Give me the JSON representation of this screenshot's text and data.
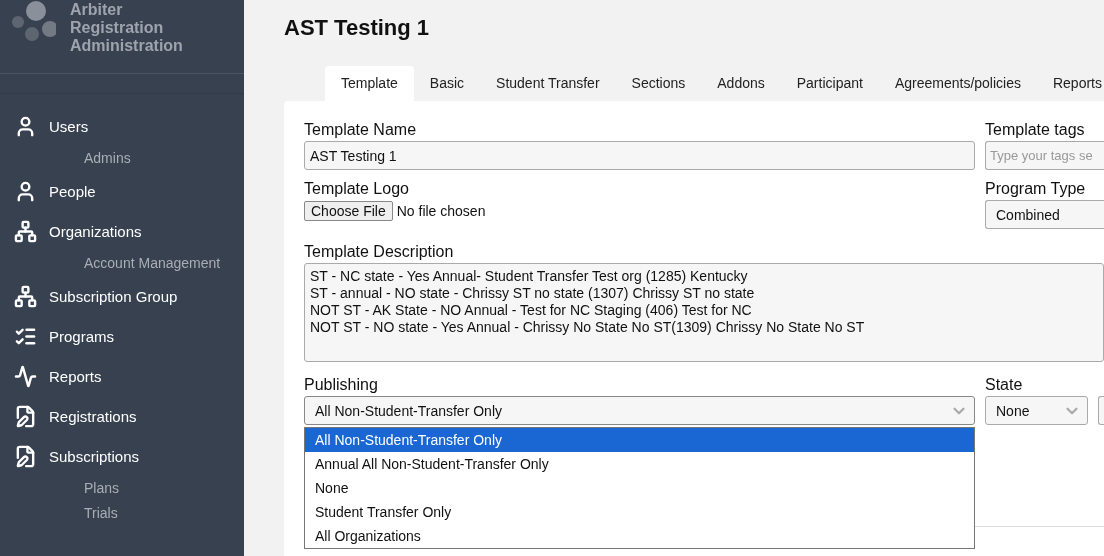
{
  "logo": {
    "lines": [
      "Arbiter",
      "Registration",
      "Administration"
    ]
  },
  "sidebar": {
    "items": [
      {
        "label": "Users",
        "kind": "user",
        "children": [
          {
            "label": "Admins"
          }
        ]
      },
      {
        "label": "People",
        "kind": "user"
      },
      {
        "label": "Organizations",
        "kind": "org",
        "children": [
          {
            "label": "Account Management"
          }
        ]
      },
      {
        "label": "Subscription Group",
        "kind": "org"
      },
      {
        "label": "Programs",
        "kind": "checklist"
      },
      {
        "label": "Reports",
        "kind": "chart"
      },
      {
        "label": "Registrations",
        "kind": "edit"
      },
      {
        "label": "Subscriptions",
        "kind": "edit",
        "children": [
          {
            "label": "Plans"
          },
          {
            "label": "Trials"
          }
        ]
      }
    ]
  },
  "page": {
    "title": "AST Testing 1"
  },
  "tabs": [
    {
      "label": "Template",
      "selected": true
    },
    {
      "label": "Basic",
      "selected": false
    },
    {
      "label": "Student Transfer",
      "selected": false
    },
    {
      "label": "Sections",
      "selected": false
    },
    {
      "label": "Addons",
      "selected": false
    },
    {
      "label": "Participant",
      "selected": false
    },
    {
      "label": "Agreements/policies",
      "selected": false
    },
    {
      "label": "Reports",
      "selected": false
    }
  ],
  "form": {
    "template_name": {
      "label": "Template Name",
      "value": "AST Testing 1"
    },
    "template_tags": {
      "label": "Template tags",
      "placeholder": "Type your tags se"
    },
    "template_logo": {
      "label": "Template Logo",
      "button": "Choose File",
      "status": "No file chosen"
    },
    "program_type": {
      "label": "Program Type",
      "value": "Combined"
    },
    "description": {
      "label": "Template Description",
      "lines": [
        "ST - NC state - Yes Annual- Student Transfer Test org (1285) Kentucky",
        "ST - annual - NO state - Chrissy ST no state (1307) Chrissy ST no state",
        "NOT ST - AK State - NO Annual - Test for NC Staging (406) Test for NC",
        "NOT ST - NO state - Yes Annual - Chrissy No State No ST(1309) Chrissy No State No ST"
      ]
    },
    "publishing": {
      "label": "Publishing",
      "value": "All Non-Student-Transfer Only",
      "expanded": true,
      "options": [
        {
          "label": "All Non-Student-Transfer Only",
          "selected": true
        },
        {
          "label": "Annual All Non-Student-Transfer Only",
          "selected": false
        },
        {
          "label": "None",
          "selected": false
        },
        {
          "label": "Student Transfer Only",
          "selected": false
        },
        {
          "label": "All Organizations",
          "selected": false
        }
      ]
    },
    "state": {
      "label": "State",
      "value": "None"
    }
  }
}
